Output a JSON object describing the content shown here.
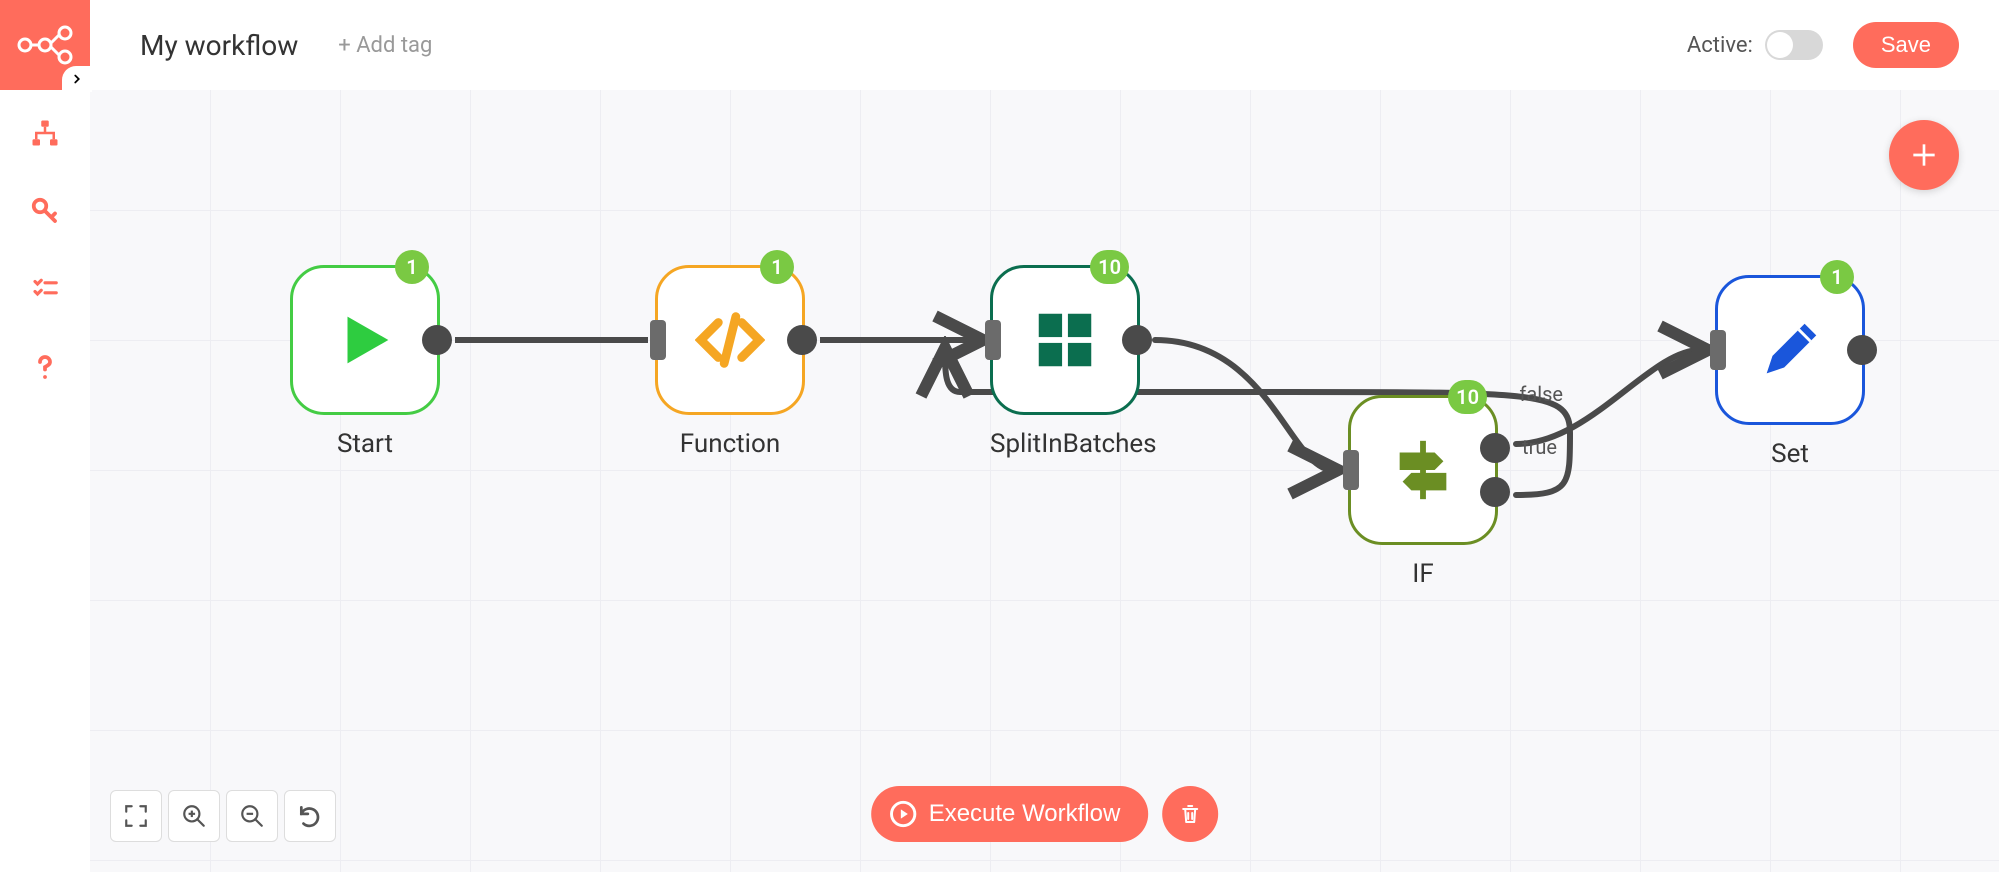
{
  "header": {
    "workflow_name": "My workflow",
    "add_tag": "+ Add tag",
    "active_label": "Active:",
    "save_label": "Save"
  },
  "nodes": {
    "start": {
      "label": "Start",
      "badge": "1"
    },
    "function": {
      "label": "Function",
      "badge": "1"
    },
    "split": {
      "label": "SplitInBatches",
      "badge": "10"
    },
    "if": {
      "label": "IF",
      "badge": "10",
      "true_label": "true",
      "false_label": "false"
    },
    "set": {
      "label": "Set",
      "badge": "1"
    }
  },
  "buttons": {
    "execute": "Execute Workflow"
  }
}
